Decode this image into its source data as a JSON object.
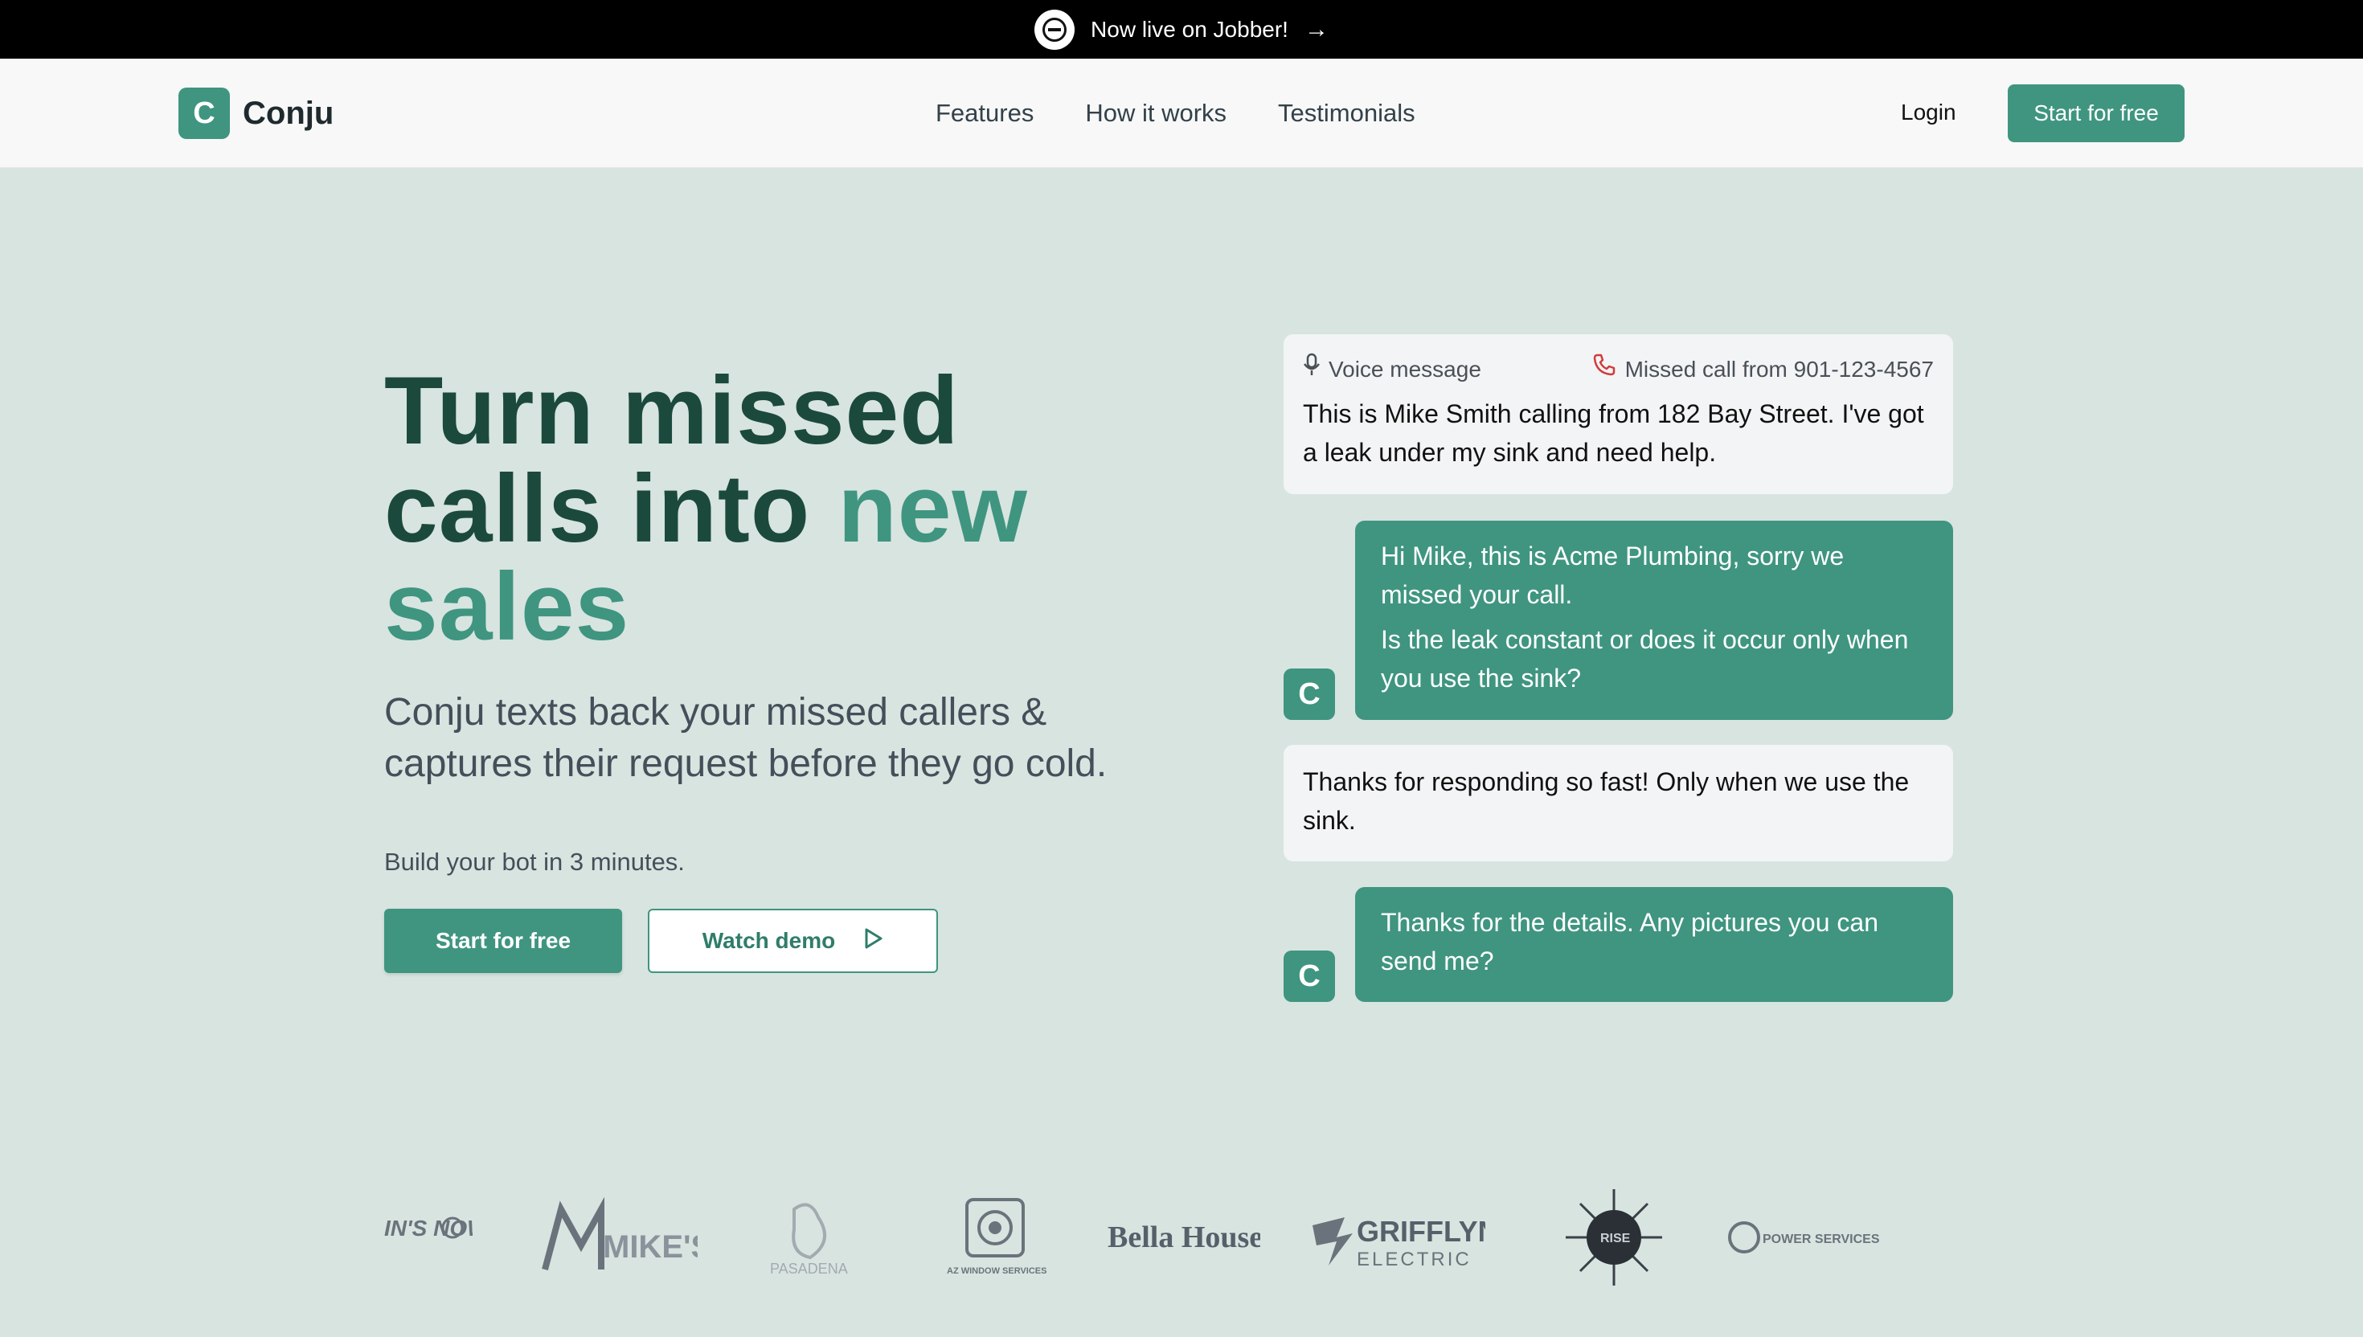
{
  "announcement": {
    "text": "Now live on Jobber!"
  },
  "nav": {
    "brand_initial": "C",
    "brand_name": "Conju",
    "links": [
      "Features",
      "How it works",
      "Testimonials"
    ],
    "login": "Login",
    "cta": "Start for free"
  },
  "hero": {
    "title_line1": "Turn missed",
    "title_line2_dark": "calls into",
    "title_line2_accent": "new",
    "title_line3_accent": "sales",
    "subtitle": "Conju texts back your missed callers & captures their request before they go cold.",
    "note": "Build your bot in 3 minutes.",
    "primary_button": "Start for free",
    "secondary_button": "Watch demo"
  },
  "chat": {
    "voice_label": "Voice message",
    "missed_call": "Missed call from 901-123-4567",
    "voice_text": "This is Mike Smith calling from 182 Bay Street. I've got a leak under my sink and need help.",
    "reply1_line1": "Hi Mike, this is Acme Plumbing, sorry we missed your call.",
    "reply1_line2": "Is the leak constant or does it occur only when you use the sink?",
    "customer2": "Thanks for responding so fast! Only when we use the sink.",
    "reply2": "Thanks for the details. Any pictures you can send me?",
    "avatar_initial": "C"
  },
  "logos": [
    "IN'S NOW",
    "MIKE'S",
    "PASADENA",
    "AZ WINDOW SERVICES",
    "Bella House",
    "GRIFFLYN",
    "ELECTRIC",
    "RISE",
    "POWER SERVICES"
  ],
  "colors": {
    "accent": "#3f9580",
    "dark_green": "#1b4a3d",
    "background": "#d8e4e0"
  }
}
